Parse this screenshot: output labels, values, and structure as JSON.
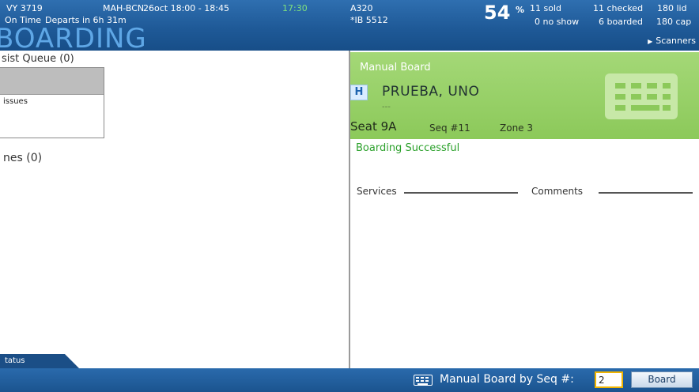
{
  "header": {
    "flight": "VY 3719",
    "flight_status": "On Time",
    "departs": "Departs in 6h 31m",
    "route": "MAH-BCN",
    "schedule": "26oct 18:00 - 18:45",
    "current_time": "17:30",
    "aircraft": "A320",
    "codeshare": "*IB 5512",
    "load_pct": "54",
    "load_pct_sign": "%",
    "sold": "11 sold",
    "no_show": "0 no show",
    "checked": "11 checked",
    "boarded": "6 boarded",
    "lid": "180 lid",
    "cap": "180 cap",
    "title": "BOARDING",
    "scanners_label": "Scanners"
  },
  "left": {
    "queue_title": "sist Queue (0)",
    "queue_item_text": "issues",
    "lines_title": "nes (0)",
    "status_tab": "tatus"
  },
  "right": {
    "panel_title": "Manual Board",
    "class_badge": "H",
    "passenger_name": "PRUEBA, UNO",
    "passenger_extra": "---",
    "seat": "Seat 9A",
    "seq": "Seq #11",
    "zone": "Zone 3",
    "result": "Boarding Successful",
    "services_label": "Services",
    "comments_label": "Comments"
  },
  "footer": {
    "label": "Manual Board by Seq #:",
    "seq_value": "2",
    "board_button": "Board"
  },
  "colors": {
    "header_blue": "#1f5a98",
    "success_green": "#2ca12c",
    "panel_green": "#8cc95a",
    "input_border": "#f0b400"
  },
  "icons": [
    "keyboard-icon",
    "triangle-right-icon"
  ]
}
